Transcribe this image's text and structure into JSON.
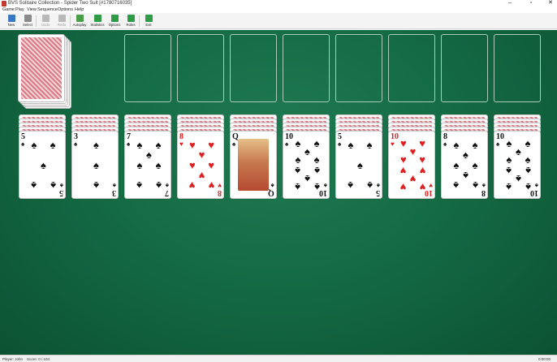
{
  "window": {
    "title": "BVS Solitaire Collection - Spider Two Suit [#1780716035]",
    "controls": {
      "minimize": "–",
      "maximize": "▫",
      "close": "✕"
    }
  },
  "menu": [
    "Game",
    "Play",
    "View",
    "Sequence",
    "Options",
    "Help"
  ],
  "toolbar": [
    {
      "label": "New",
      "icon": "new-game-icon",
      "color": "#3a78c2",
      "enabled": true
    },
    {
      "label": "Select",
      "icon": "select-game-icon",
      "color": "#8a8a8a",
      "enabled": true
    },
    {
      "label": "Undo",
      "icon": "undo-icon",
      "color": "#b9b9b9",
      "enabled": false
    },
    {
      "label": "Redo",
      "icon": "redo-icon",
      "color": "#b9b9b9",
      "enabled": false
    },
    {
      "label": "Autoplay",
      "icon": "autoplay-icon",
      "color": "#4aa04a",
      "enabled": true
    },
    {
      "label": "Statistics",
      "icon": "statistics-icon",
      "color": "#2e9b47",
      "enabled": true
    },
    {
      "label": "Options",
      "icon": "options-icon",
      "color": "#2e9b47",
      "enabled": true
    },
    {
      "label": "Rules",
      "icon": "rules-icon",
      "color": "#2e9b47",
      "enabled": true
    },
    {
      "label": "Exit",
      "icon": "exit-icon",
      "color": "#2e9b47",
      "enabled": true
    }
  ],
  "game": {
    "stock": {
      "label": "stock"
    },
    "foundation_count": 8,
    "tableau": [
      {
        "rank": "5",
        "suit": "♠",
        "color": "black"
      },
      {
        "rank": "3",
        "suit": "♠",
        "color": "black"
      },
      {
        "rank": "7",
        "suit": "♠",
        "color": "black"
      },
      {
        "rank": "8",
        "suit": "♥",
        "color": "red"
      },
      {
        "rank": "Q",
        "suit": "♠",
        "color": "black"
      },
      {
        "rank": "10",
        "suit": "♠",
        "color": "black"
      },
      {
        "rank": "5",
        "suit": "♠",
        "color": "black"
      },
      {
        "rank": "10",
        "suit": "♥",
        "color": "red"
      },
      {
        "rank": "8",
        "suit": "♠",
        "color": "black"
      },
      {
        "rank": "10",
        "suit": "♠",
        "color": "black"
      }
    ]
  },
  "status": {
    "player": "Player: John",
    "score": "Score: 0 / 104",
    "time": "0:00:00"
  },
  "colors": {
    "felt": "#146b44",
    "red_suit": "#e02020",
    "black_suit": "#111111"
  }
}
